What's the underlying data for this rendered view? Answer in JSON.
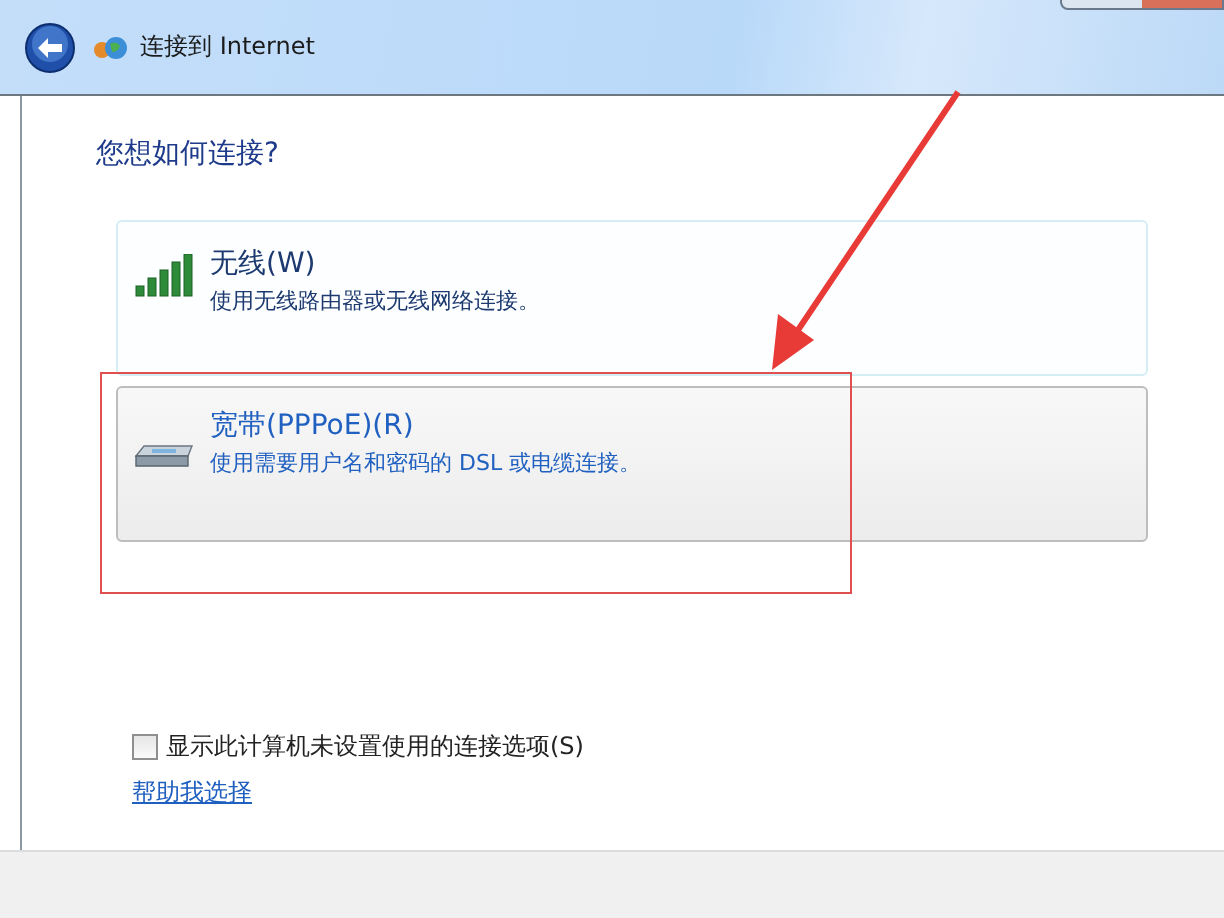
{
  "window": {
    "title": "连接到 Internet"
  },
  "heading": "您想如何连接?",
  "options": [
    {
      "kind": "wireless",
      "title": "无线(W)",
      "description": "使用无线路由器或无线网络连接。",
      "selected": false
    },
    {
      "kind": "broadband",
      "title": "宽带(PPPoE)(R)",
      "description": "使用需要用户名和密码的 DSL 或电缆连接。",
      "selected": true
    }
  ],
  "show_unconfigured": {
    "label": "显示此计算机未设置使用的连接选项(S)",
    "checked": false
  },
  "help_link": "帮助我选择"
}
